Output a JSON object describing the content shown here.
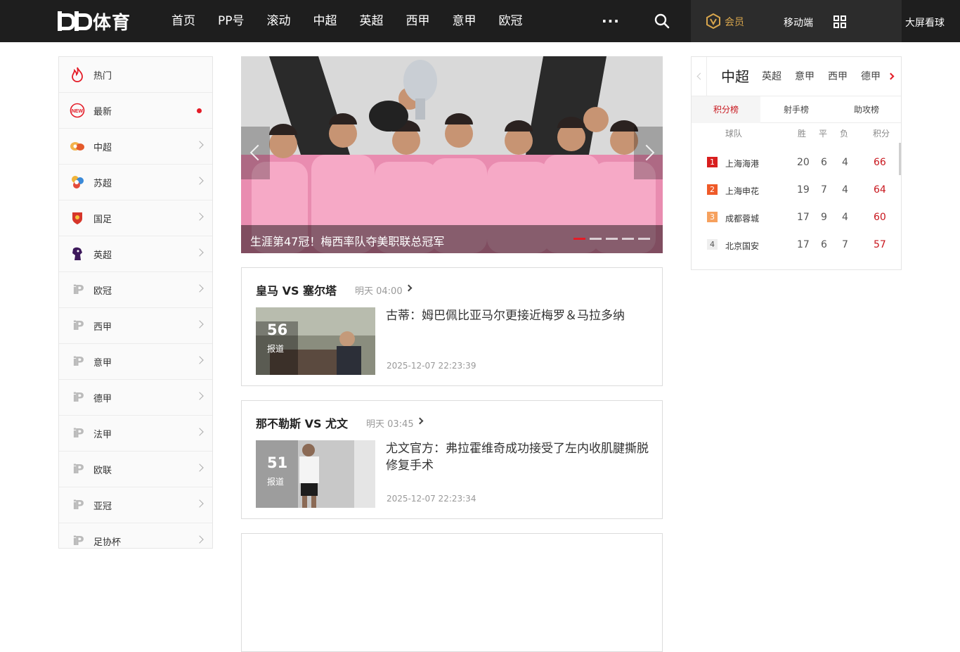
{
  "logo": {
    "text": "体育"
  },
  "nav": {
    "items": [
      "首页",
      "PP号",
      "滚动",
      "中超",
      "英超",
      "西甲",
      "意甲",
      "欧冠"
    ],
    "more": "···",
    "member": "会员",
    "mobile": "移动端",
    "bigscreen": "大屏看球"
  },
  "sidebar": {
    "items": [
      {
        "label": "热门",
        "icon": "flame-icon"
      },
      {
        "label": "最新",
        "icon": "new-badge-icon",
        "dot": true
      },
      {
        "label": "中超",
        "icon": "csl-logo-icon"
      },
      {
        "label": "苏超",
        "icon": "jiangsu-league-icon"
      },
      {
        "label": "国足",
        "icon": "china-team-crest-icon"
      },
      {
        "label": "英超",
        "icon": "premier-league-icon"
      },
      {
        "label": "欧冠",
        "icon": "pp-logo-icon"
      },
      {
        "label": "西甲",
        "icon": "pp-logo-icon"
      },
      {
        "label": "意甲",
        "icon": "pp-logo-icon"
      },
      {
        "label": "德甲",
        "icon": "pp-logo-icon"
      },
      {
        "label": "法甲",
        "icon": "pp-logo-icon"
      },
      {
        "label": "欧联",
        "icon": "pp-logo-icon"
      },
      {
        "label": "亚冠",
        "icon": "pp-logo-icon"
      },
      {
        "label": "足协杯",
        "icon": "pp-logo-icon"
      }
    ]
  },
  "hero": {
    "caption": "生涯第47冠！梅西率队夺美职联总冠军",
    "slides": 5,
    "active_slide": 1
  },
  "matches": [
    {
      "title": "皇马 VS 塞尔塔",
      "time": "明天 04:00",
      "count": "56",
      "count_label": "报道",
      "headline": "古蒂：姆巴佩比亚马尔更接近梅罗＆马拉多纳",
      "date": "2025-12-07 22:23:39"
    },
    {
      "title": "那不勒斯 VS 尤文",
      "time": "明天 03:45",
      "count": "51",
      "count_label": "报道",
      "headline": "尤文官方：弗拉霍维奇成功接受了左内收肌腱撕脱修复手术",
      "date": "2025-12-07 22:23:34"
    }
  ],
  "standings": {
    "leagues": [
      "中超",
      "英超",
      "意甲",
      "西甲",
      "德甲"
    ],
    "active_league": "中超",
    "tabs": [
      "积分榜",
      "射手榜",
      "助攻榜"
    ],
    "active_tab": "积分榜",
    "headers": {
      "team": "球队",
      "w": "胜",
      "d": "平",
      "l": "负",
      "pts": "积分"
    },
    "rows": [
      {
        "rank": "1",
        "team": "上海海港",
        "w": "20",
        "d": "6",
        "l": "4",
        "pts": "66",
        "color": "#d81e1e"
      },
      {
        "rank": "2",
        "team": "上海申花",
        "w": "19",
        "d": "7",
        "l": "4",
        "pts": "64",
        "color": "#ef5a28"
      },
      {
        "rank": "3",
        "team": "成都蓉城",
        "w": "17",
        "d": "9",
        "l": "4",
        "pts": "60",
        "color": "#f6a15e"
      },
      {
        "rank": "4",
        "team": "北京国安",
        "w": "17",
        "d": "6",
        "l": "7",
        "pts": "57",
        "color": "#eeeeee"
      }
    ]
  },
  "colors": {
    "accent": "#e41c27",
    "topbar": "#1e1e1e",
    "member_gold": "#d8a64d"
  }
}
